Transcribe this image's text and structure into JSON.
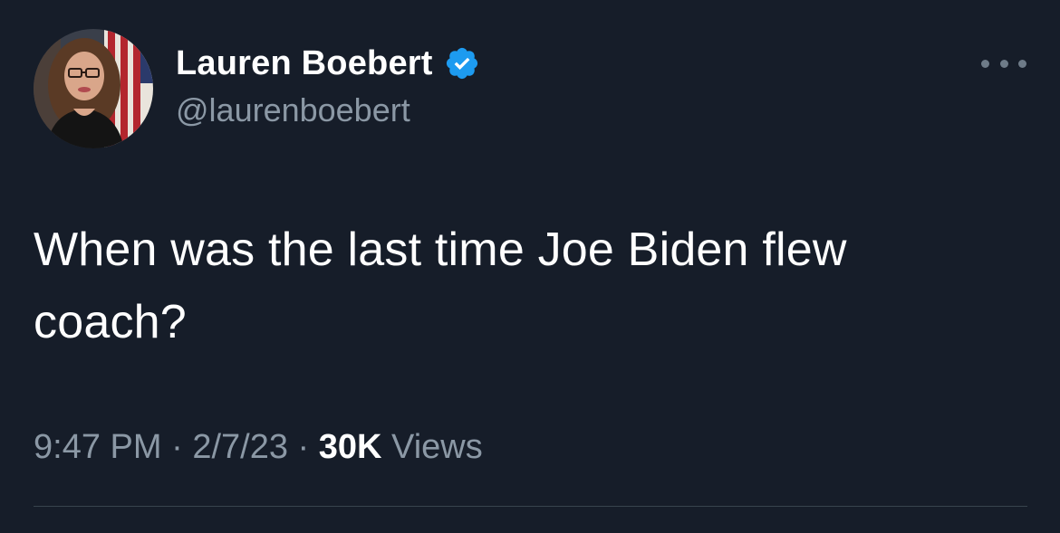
{
  "tweet": {
    "author": {
      "display_name": "Lauren Boebert",
      "handle": "@laurenboebert",
      "verified": true,
      "avatar_icon": "profile-photo"
    },
    "more_icon": "more-horizontal-icon",
    "text_line1": "When was the last time Joe Biden flew",
    "text_line2": "coach?",
    "time": "9:47 PM",
    "date": "2/7/23",
    "separator": "·",
    "views_count": "30K",
    "views_label": "Views"
  },
  "colors": {
    "background": "#161d29",
    "secondary_text": "#8b98a5",
    "verified_blue": "#1d9bf0",
    "divider": "#38444d"
  }
}
